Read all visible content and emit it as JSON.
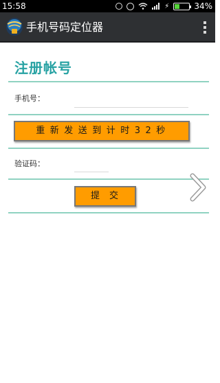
{
  "status_bar": {
    "time": "15:58",
    "battery_percent": "34%",
    "battery_level": 0.34,
    "icons": [
      "ring-icon",
      "alarm-icon",
      "wifi-icon",
      "signal-icon",
      "charging-icon",
      "battery-icon"
    ]
  },
  "app_bar": {
    "title": "手机号码定位器",
    "logo_icon": "app-logo-icon",
    "menu_icon": "overflow-menu-icon"
  },
  "form": {
    "heading": "注册帐号",
    "phone_label": "手机号：",
    "phone_value": "",
    "resend_button_label": "重新发送到计时32秒",
    "code_label": "验证码：",
    "code_value": "",
    "submit_button_label": "提交"
  },
  "colors": {
    "accent_teal": "#27a2a3",
    "divider": "#8fd2c1",
    "button_orange": "#ff9c00",
    "app_bar": "#2e3033"
  },
  "overlay": {
    "next_arrow_icon": "chevron-right-icon"
  }
}
